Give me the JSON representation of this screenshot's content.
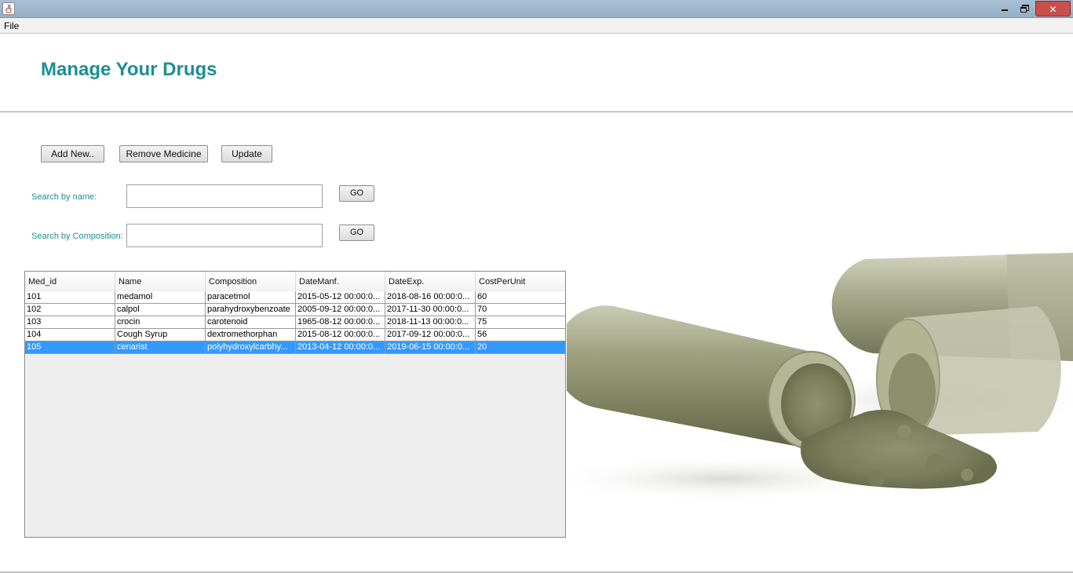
{
  "window": {
    "icon": "java-cup-icon",
    "controls": {
      "minimize": "minimize-icon",
      "maximize": "restore-icon",
      "close": "✕"
    }
  },
  "menu": {
    "file": "File"
  },
  "header": {
    "title": "Manage Your Drugs"
  },
  "toolbar": {
    "add": "Add New..",
    "remove": "Remove Medicine",
    "update": "Update"
  },
  "search": {
    "by_name_label": "Search by name:",
    "by_name_value": "",
    "by_name_go": "GO",
    "by_comp_label": "Search by Composition:",
    "by_comp_value": "",
    "by_comp_go": "GO"
  },
  "table": {
    "columns": [
      "Med_id",
      "Name",
      "Composition",
      "DateManf.",
      "DateExp.",
      "CostPerUnit"
    ],
    "rows": [
      [
        "101",
        "medamol",
        "paracetmol",
        "2015-05-12 00:00:0...",
        "2018-08-16 00:00:0...",
        "60"
      ],
      [
        "102",
        "calpol",
        "parahydroxybenzoate",
        "2005-09-12 00:00:0...",
        "2017-11-30 00:00:0...",
        "70"
      ],
      [
        "103",
        "crocin",
        "carotenoid",
        "1965-08-12 00:00:0...",
        "2018-11-13 00:00:0...",
        "75"
      ],
      [
        "104",
        "Cough Syrup",
        "dextromethorphan",
        "2015-08-12 00:00:0...",
        "2017-09-12 00:00:0...",
        "56"
      ],
      [
        "105",
        "cenarist",
        "polyhydroxylcarbhy...",
        "2013-04-12 00:00:0...",
        "2019-06-15 00:00:0...",
        "20"
      ]
    ],
    "selected_row": 4
  },
  "colors": {
    "accent": "#1a8f94",
    "selection": "#3399ff",
    "close": "#c7504a"
  },
  "image": {
    "subject": "capsule-powder-photo"
  }
}
